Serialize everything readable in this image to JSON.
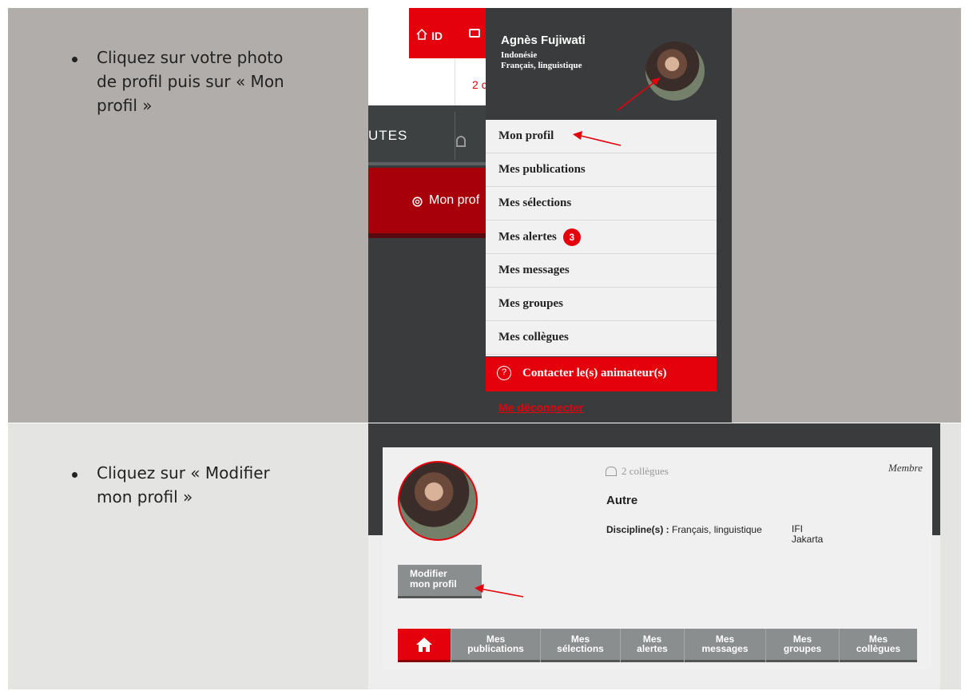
{
  "instructions": [
    {
      "text": "Cliquez sur votre photo de profil puis sur « Mon profil »"
    },
    {
      "text": "Cliquez sur « Modifier mon profil »"
    }
  ],
  "bullet_lines": {
    "step1": [
      "Cliquez sur votre photo",
      "de profil puis sur « Mon",
      "profil »"
    ],
    "step2": [
      "Cliquez sur « Modifier",
      "mon profil »"
    ]
  },
  "shot1": {
    "id_label": "ID",
    "notif_fragment": "2 c",
    "tab_fragment": "UTES",
    "mon_profil_fragment": "Mon prof",
    "user": {
      "name": "Agnès Fujiwati",
      "country": "Indonésie",
      "discipline": "Français, linguistique"
    },
    "menu": [
      {
        "label": "Mon profil"
      },
      {
        "label": "Mes publications"
      },
      {
        "label": "Mes sélections"
      },
      {
        "label": "Mes alertes",
        "badge": "3"
      },
      {
        "label": "Mes messages"
      },
      {
        "label": "Mes groupes"
      },
      {
        "label": "Mes collègues"
      }
    ],
    "contact_label": "Contacter le(s) animateur(s)",
    "logout_label": "Me déconnecter"
  },
  "shot2": {
    "colleagues": "2 collègues",
    "role": "Membre",
    "status": "Autre",
    "discipline_label": "Discipline(s) :",
    "discipline_value": "Français, linguistique",
    "institution": "IFI",
    "city": "Jakarta",
    "modify_button": [
      "Modifier",
      "mon profil"
    ],
    "nav": [
      {
        "line1": "Mes",
        "line2": "publications"
      },
      {
        "line1": "Mes",
        "line2": "sélections"
      },
      {
        "line1": "Mes",
        "line2": "alertes"
      },
      {
        "line1": "Mes",
        "line2": "messages"
      },
      {
        "line1": "Mes",
        "line2": "groupes"
      },
      {
        "line1": "Mes",
        "line2": "collègues"
      }
    ]
  },
  "colors": {
    "brand_red": "#e4010b",
    "dark_header": "#393b3c",
    "row1_bg": "#b1adab",
    "row2_bg": "#e4e4e3",
    "nav_grey": "#8b8e8f"
  },
  "icons": [
    "house-id-icon",
    "message-icon",
    "user-icon",
    "gear-icon",
    "question-icon",
    "colleagues-icon",
    "home-icon",
    "arrow-annotation"
  ]
}
